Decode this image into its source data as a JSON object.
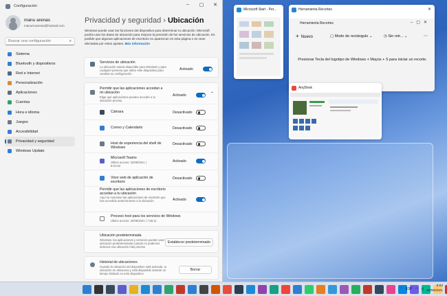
{
  "settings": {
    "app_title": "Configuración",
    "user": {
      "name": "manu arenas",
      "email": "manuel.arenas@hotmail.com"
    },
    "search_placeholder": "Buscar una configuración",
    "nav": [
      {
        "label": "Sistema",
        "icon": "monitor-icon",
        "color": "#3a7bd5"
      },
      {
        "label": "Bluetooth y dispositivos",
        "icon": "bluetooth-icon",
        "color": "#2f7fd1"
      },
      {
        "label": "Red e Internet",
        "icon": "network-icon",
        "color": "#4d6b8a"
      },
      {
        "label": "Personalización",
        "icon": "brush-icon",
        "color": "#d98b3a"
      },
      {
        "label": "Aplicaciones",
        "icon": "apps-icon",
        "color": "#5a6f86"
      },
      {
        "label": "Cuentas",
        "icon": "person-icon",
        "color": "#2fa36b"
      },
      {
        "label": "Hora e idioma",
        "icon": "globe-icon",
        "color": "#2f7fd1"
      },
      {
        "label": "Juegos",
        "icon": "gamepad-icon",
        "color": "#6c7a89"
      },
      {
        "label": "Accesibilidad",
        "icon": "accessibility-icon",
        "color": "#3a7bd5"
      },
      {
        "label": "Privacidad y seguridad",
        "icon": "shield-icon",
        "color": "#6c7a89",
        "active": true
      },
      {
        "label": "Windows Update",
        "icon": "update-icon",
        "color": "#2f7fd1"
      }
    ],
    "breadcrumb": {
      "parent": "Privacidad y seguridad",
      "separator": "›",
      "current": "Ubicación"
    },
    "description": "Windows puede usar las funciones del dispositivo para determinar tu ubicación. Microsoft podría usar los datos de ubicación para mejorar la precisión de los servicios de ubicación. Es posible que algunas aplicaciones de escritorio no aparezcan en esta página o se vean afectadas por estos ajustes.",
    "more_info": "Más información",
    "location_services": {
      "title": "Servicios de ubicación",
      "subtitle": "La ubicación estará disponible para Windows y para cualquier persona que utilice este dispositivo para cambiar su configuración",
      "state": "Activado"
    },
    "app_access": {
      "title": "Permitir que las aplicaciones accedan a mi ubicación",
      "subtitle": "Elige qué aplicaciones pueden acceder a tu ubicación precisa",
      "state": "Activado"
    },
    "apps": [
      {
        "name": "Cámara",
        "sub": "",
        "state": "Desactivado",
        "on": false,
        "color": "#3a4a5c"
      },
      {
        "name": "Correo y Calendario",
        "sub": "",
        "state": "Desactivado",
        "on": false,
        "color": "#2f7fd1"
      },
      {
        "name": "Host de experiencia del shell de Windows",
        "sub": "",
        "state": "Desactivado",
        "on": false,
        "color": "#6c7a89"
      },
      {
        "name": "Microsoft Teams",
        "sub": "Último acceso: 20/08/2021 | 8:01:53",
        "state": "Activado",
        "on": true,
        "color": "#5b5fc7"
      },
      {
        "name": "Visor web de aplicación de escritorio",
        "sub": "",
        "state": "Desactivado",
        "on": false,
        "color": "#2f7fd1"
      }
    ],
    "desktop_apps": {
      "title": "Permitir que las aplicaciones de escritorio accedan a tu ubicación",
      "subtitle": "Aquí se muestran las aplicaciones de escritorio que han accedido anteriormente a la ubicación",
      "state": "Activado"
    },
    "host_process": {
      "title": "Proceso host para los servicios de Windows",
      "sub": "Último acceso: 20/08/2021 | 7:55:11"
    },
    "default_location": {
      "title": "Ubicación predeterminada",
      "subtitle": "Windows, las aplicaciones y servicios pueden usar la ubicación predeterminada cuando no podemos detectar una ubicación más precisa",
      "button": "Establecer predeterminado"
    },
    "history": {
      "title": "Historial de ubicaciones",
      "subtitle": "Cuando la ubicación del dispositivo está activada, tu ubicación se almacena y está disponible durante un tiempo limitado en este dispositivo",
      "button": "Borrar"
    }
  },
  "task_view": {
    "msstart_title": "Microsoft Start - Per...",
    "recortes_title": "Herramienta Recortes",
    "recortes_app_title": "Herramienta Recortes",
    "recortes_new": "Nuevo",
    "recortes_mode": "Modo de rectángulo",
    "recortes_delay": "Sin retr...",
    "recortes_message": "Presionar Tecla del logotipo de Windows + Mayús + S para iniciar un recorte.",
    "anydesk_title": "AnyDesk"
  },
  "taskbar": {
    "lang": "ESP",
    "time": "8:03",
    "date": "20/08/2021"
  }
}
